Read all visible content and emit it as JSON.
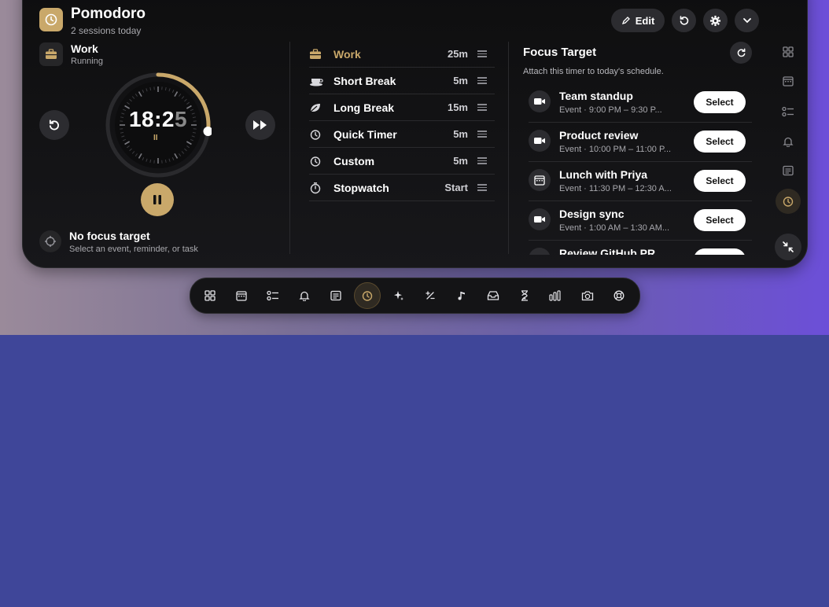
{
  "colors": {
    "accent": "#c9a86a",
    "panel_bg": "#111113",
    "chip_bg": "#2c2c30",
    "text_secondary": "#a8a8ad"
  },
  "header": {
    "app_icon": "timer-icon",
    "title": "Pomodoro",
    "subtitle": "2 sessions today",
    "edit_label": "Edit",
    "buttons": [
      "pencil-icon",
      "reset-icon",
      "gear-icon",
      "chevron-down-icon"
    ]
  },
  "timer": {
    "mode_icon": "briefcase-icon",
    "mode_label": "Work",
    "status": "Running",
    "time_main": "18:2",
    "time_blur": "5",
    "progress": 0.27,
    "paused_glyph": "II"
  },
  "focus": {
    "title": "No focus target",
    "subtitle": "Select an event, reminder, or task"
  },
  "modes": [
    {
      "icon": "briefcase-icon",
      "name": "Work",
      "duration": "25m",
      "active": true
    },
    {
      "icon": "coffee-icon",
      "name": "Short Break",
      "duration": "5m",
      "active": false
    },
    {
      "icon": "leaf-icon",
      "name": "Long Break",
      "duration": "15m",
      "active": false
    },
    {
      "icon": "timer-icon",
      "name": "Quick Timer",
      "duration": "5m",
      "active": false
    },
    {
      "icon": "timer-icon",
      "name": "Custom",
      "duration": "5m",
      "active": false
    },
    {
      "icon": "stopwatch-icon",
      "name": "Stopwatch",
      "duration": "Start",
      "active": false
    }
  ],
  "focus_target": {
    "title": "Focus Target",
    "subtitle": "Attach this timer to today's schedule.",
    "events": [
      {
        "icon": "video-icon",
        "title": "Team standup",
        "detail": "Event · 9:00 PM – 9:30 P...",
        "action": "Select"
      },
      {
        "icon": "video-icon",
        "title": "Product review",
        "detail": "Event · 10:00 PM – 11:00 P...",
        "action": "Select"
      },
      {
        "icon": "calendar-icon",
        "title": "Lunch with Priya",
        "detail": "Event · 11:30 PM – 12:30 A...",
        "action": "Select"
      },
      {
        "icon": "video-icon",
        "title": "Design sync",
        "detail": "Event · 1:00 AM – 1:30 AM...",
        "action": "Select"
      },
      {
        "icon": "video-icon",
        "title": "Review GitHub PR",
        "detail": "",
        "action": "Select"
      }
    ]
  },
  "rail": [
    "grid-icon",
    "calendar-icon",
    "checklist-icon",
    "bell-icon",
    "notes-icon",
    "timer-icon",
    "collapse-icon"
  ],
  "dock": [
    "grid-icon",
    "calendar-icon",
    "checklist-icon",
    "bell-icon",
    "notes-icon",
    "timer-icon",
    "sparkle-icon",
    "calculator-icon",
    "music-icon",
    "inbox-icon",
    "hourglass-icon",
    "bars-icon",
    "camera-icon",
    "lifebuoy-icon"
  ]
}
